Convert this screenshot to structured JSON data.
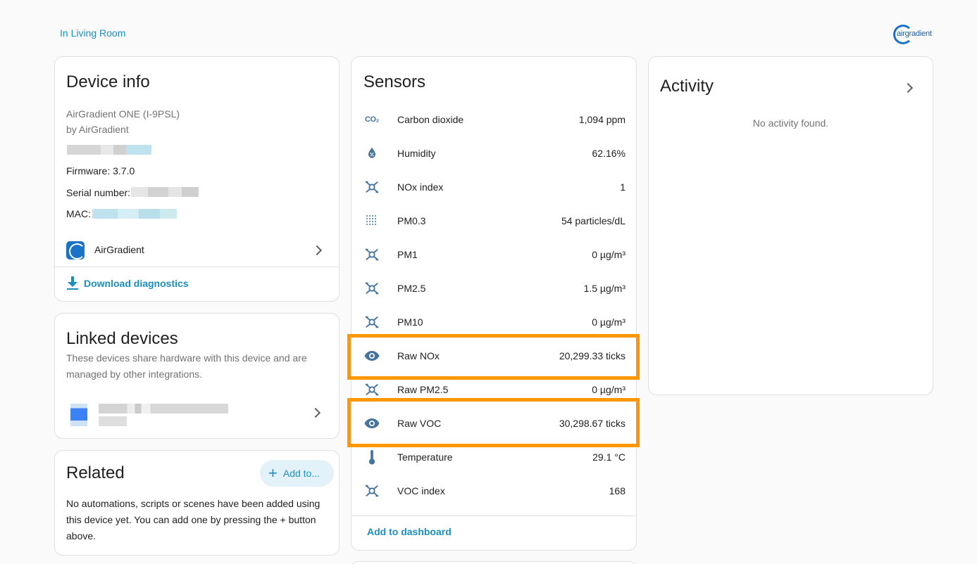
{
  "header": {
    "area_link": "In Living Room",
    "brand": "airgradient"
  },
  "device_info": {
    "title": "Device info",
    "model": "AirGradient ONE (I-9PSL)",
    "manufacturer": "by AirGradient",
    "firmware": "Firmware: 3.7.0",
    "serial_label": "Serial number:",
    "mac_label": "MAC:",
    "integration": "AirGradient",
    "download": "Download diagnostics"
  },
  "linked_devices": {
    "title": "Linked devices",
    "description": "These devices share hardware with this device and are managed by other integrations."
  },
  "related": {
    "title": "Related",
    "add_button": "Add to...",
    "text": "No automations, scripts or scenes have been added using this device yet. You can add one by pressing the + button above."
  },
  "sensors": {
    "title": "Sensors",
    "items": [
      {
        "name": "Carbon dioxide",
        "value": "1,094 ppm",
        "icon": "co2-icon"
      },
      {
        "name": "Humidity",
        "value": "62.16%",
        "icon": "water-percent-icon"
      },
      {
        "name": "NOx index",
        "value": "1",
        "icon": "molecule-icon"
      },
      {
        "name": "PM0.3",
        "value": "54 particles/dL",
        "icon": "dots-grid-icon"
      },
      {
        "name": "PM1",
        "value": "0 µg/m³",
        "icon": "molecule-icon"
      },
      {
        "name": "PM2.5",
        "value": "1.5 µg/m³",
        "icon": "molecule-icon"
      },
      {
        "name": "PM10",
        "value": "0 µg/m³",
        "icon": "molecule-icon"
      },
      {
        "name": "Raw NOx",
        "value": "20,299.33 ticks",
        "icon": "eye-icon"
      },
      {
        "name": "Raw PM2.5",
        "value": "0 µg/m³",
        "icon": "molecule-icon"
      },
      {
        "name": "Raw VOC",
        "value": "30,298.67 ticks",
        "icon": "eye-icon"
      },
      {
        "name": "Temperature",
        "value": "29.1 °C",
        "icon": "thermometer-icon"
      },
      {
        "name": "VOC index",
        "value": "168",
        "icon": "molecule-icon"
      }
    ],
    "add_to_dashboard": "Add to dashboard"
  },
  "activity": {
    "title": "Activity",
    "empty": "No activity found."
  },
  "colors": {
    "accent": "#1a8fbf",
    "icon": "#44739e",
    "highlight": "#ff9800"
  }
}
